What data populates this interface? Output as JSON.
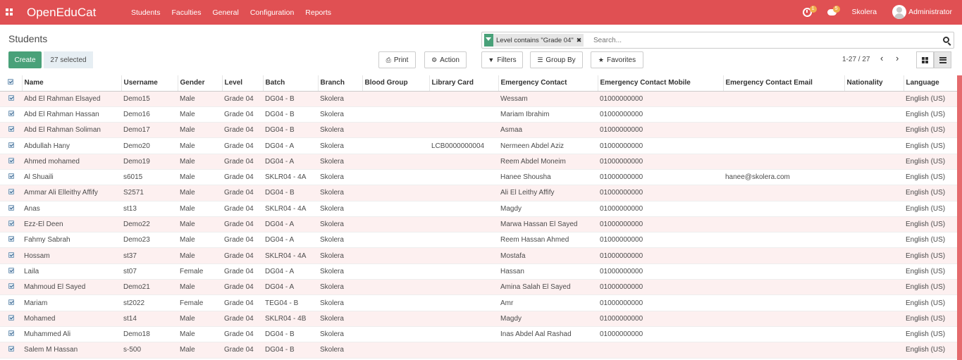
{
  "navbar": {
    "brand": "OpenEduCat",
    "menu": [
      "Students",
      "Faculties",
      "General",
      "Configuration",
      "Reports"
    ],
    "activity_count": "1",
    "messages_count": "5",
    "company": "Skolera",
    "user": "Administrator",
    "color": "#e05053"
  },
  "page": {
    "title": "Students",
    "create_label": "Create",
    "selected_label": "27 selected",
    "print_label": "Print",
    "action_label": "Action",
    "filters_label": "Filters",
    "groupby_label": "Group By",
    "favorites_label": "Favorites",
    "pager": "1-27 / 27",
    "prev_icon": "‹",
    "next_icon": "›"
  },
  "search": {
    "facet": "Level contains \"Grade 04\"",
    "placeholder": "Search..."
  },
  "table": {
    "columns": [
      "Name",
      "Username",
      "Gender",
      "Level",
      "Batch",
      "Branch",
      "Blood Group",
      "Library Card",
      "Emergency Contact",
      "Emergency Contact Mobile",
      "Emergency Contact Email",
      "Nationality",
      "Language"
    ],
    "rows": [
      [
        "Abd El Rahman Elsayed",
        "Demo15",
        "Male",
        "Grade 04",
        "DG04 - B",
        "Skolera",
        "",
        "",
        "Wessam",
        "01000000000",
        "",
        "",
        "English (US)"
      ],
      [
        "Abd El Rahman Hassan",
        "Demo16",
        "Male",
        "Grade 04",
        "DG04 - B",
        "Skolera",
        "",
        "",
        "Mariam Ibrahim",
        "01000000000",
        "",
        "",
        "English (US)"
      ],
      [
        "Abd El Rahman Soliman",
        "Demo17",
        "Male",
        "Grade 04",
        "DG04 - B",
        "Skolera",
        "",
        "",
        "Asmaa",
        "01000000000",
        "",
        "",
        "English (US)"
      ],
      [
        "Abdullah Hany",
        "Demo20",
        "Male",
        "Grade 04",
        "DG04 - A",
        "Skolera",
        "",
        "LCB0000000004",
        "Nermeen Abdel Aziz",
        "01000000000",
        "",
        "",
        "English (US)"
      ],
      [
        "Ahmed mohamed",
        "Demo19",
        "Male",
        "Grade 04",
        "DG04 - A",
        "Skolera",
        "",
        "",
        "Reem Abdel Moneim",
        "01000000000",
        "",
        "",
        "English (US)"
      ],
      [
        "Al Shuaili",
        "s6015",
        "Male",
        "Grade 04",
        "SKLR04 - 4A",
        "Skolera",
        "",
        "",
        "Hanee Shousha",
        "01000000000",
        "hanee@skolera.com",
        "",
        "English (US)"
      ],
      [
        "Ammar Ali Elleithy Affify",
        "S2571",
        "Male",
        "Grade 04",
        "DG04 - B",
        "Skolera",
        "",
        "",
        "Ali El Leithy Affify",
        "01000000000",
        "",
        "",
        "English (US)"
      ],
      [
        "Anas",
        "st13",
        "Male",
        "Grade 04",
        "SKLR04 - 4A",
        "Skolera",
        "",
        "",
        "Magdy",
        "01000000000",
        "",
        "",
        "English (US)"
      ],
      [
        "Ezz-El Deen",
        "Demo22",
        "Male",
        "Grade 04",
        "DG04 - A",
        "Skolera",
        "",
        "",
        "Marwa Hassan El Sayed",
        "01000000000",
        "",
        "",
        "English (US)"
      ],
      [
        "Fahmy Sabrah",
        "Demo23",
        "Male",
        "Grade 04",
        "DG04 - A",
        "Skolera",
        "",
        "",
        "Reem Hassan Ahmed",
        "01000000000",
        "",
        "",
        "English (US)"
      ],
      [
        "Hossam",
        "st37",
        "Male",
        "Grade 04",
        "SKLR04 - 4A",
        "Skolera",
        "",
        "",
        "Mostafa",
        "01000000000",
        "",
        "",
        "English (US)"
      ],
      [
        "Laila",
        "st07",
        "Female",
        "Grade 04",
        "DG04 - A",
        "Skolera",
        "",
        "",
        "Hassan",
        "01000000000",
        "",
        "",
        "English (US)"
      ],
      [
        "Mahmoud El Sayed",
        "Demo21",
        "Male",
        "Grade 04",
        "DG04 - A",
        "Skolera",
        "",
        "",
        "Amina Salah El Sayed",
        "01000000000",
        "",
        "",
        "English (US)"
      ],
      [
        "Mariam",
        "st2022",
        "Female",
        "Grade 04",
        "TEG04 - B",
        "Skolera",
        "",
        "",
        "Amr",
        "01000000000",
        "",
        "",
        "English (US)"
      ],
      [
        "Mohamed",
        "st14",
        "Male",
        "Grade 04",
        "SKLR04 - 4B",
        "Skolera",
        "",
        "",
        "Magdy",
        "01000000000",
        "",
        "",
        "English (US)"
      ],
      [
        "Muhammed Ali",
        "Demo18",
        "Male",
        "Grade 04",
        "DG04 - B",
        "Skolera",
        "",
        "",
        "Inas Abdel Aal Rashad",
        "01000000000",
        "",
        "",
        "English (US)"
      ],
      [
        "Salem M Hassan",
        "s-500",
        "Male",
        "Grade 04",
        "DG04 - B",
        "Skolera",
        "",
        "",
        "",
        "",
        "",
        "",
        "English (US)"
      ]
    ]
  }
}
